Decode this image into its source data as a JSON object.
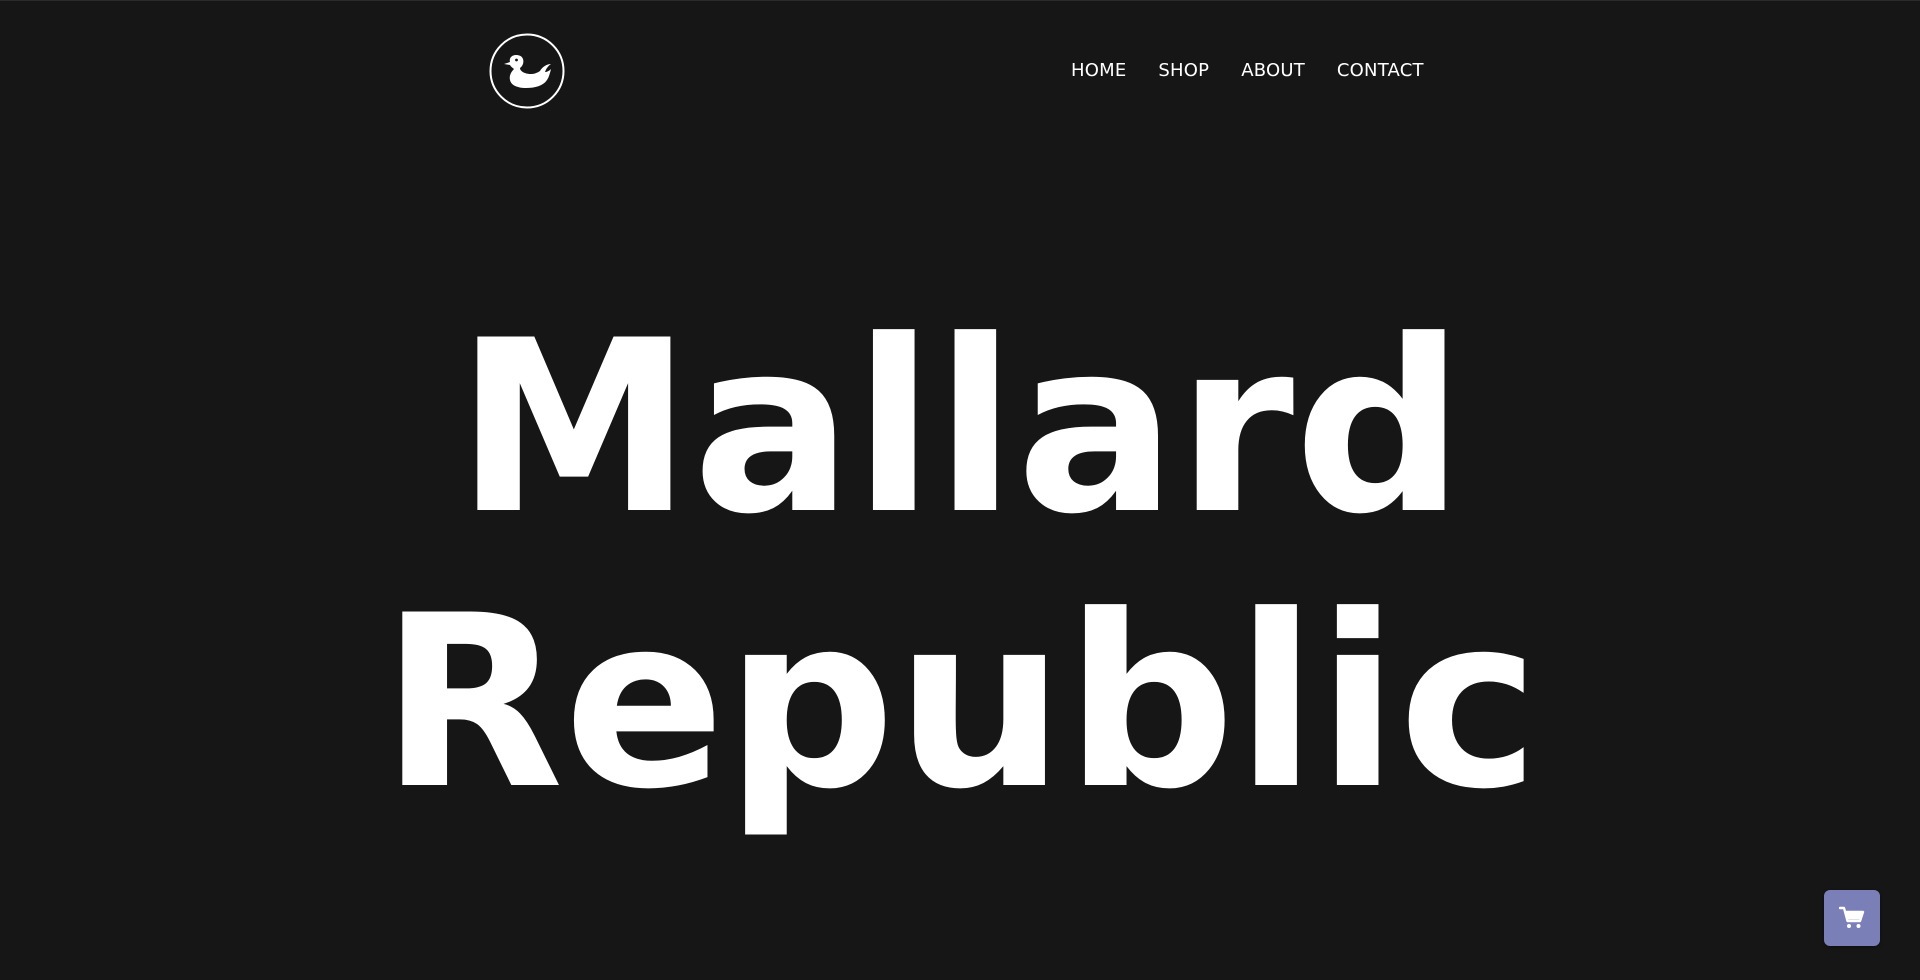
{
  "colors": {
    "background": "#161616",
    "text": "#ffffff",
    "cart_button": "#7b7fb8"
  },
  "header": {
    "logo_icon": "duck-logo-icon",
    "nav": [
      {
        "label": "HOME"
      },
      {
        "label": "SHOP"
      },
      {
        "label": "ABOUT"
      },
      {
        "label": "CONTACT"
      }
    ]
  },
  "hero": {
    "line1": "Mallard",
    "line2": "Republic"
  },
  "cart": {
    "icon": "shopping-cart-icon"
  }
}
